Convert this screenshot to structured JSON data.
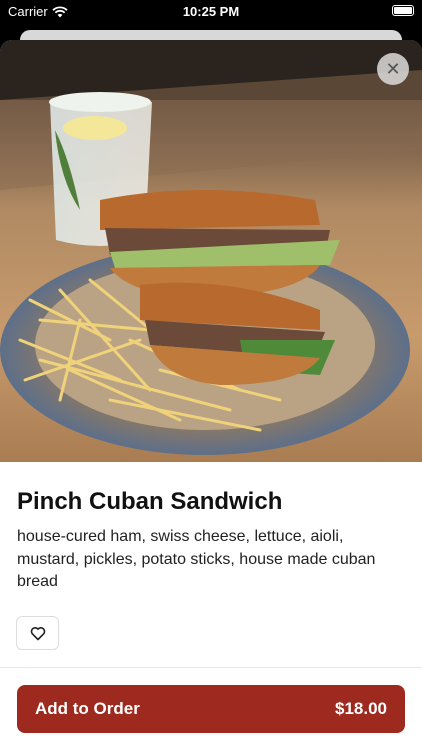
{
  "status_bar": {
    "carrier": "Carrier",
    "time": "10:25 PM"
  },
  "item": {
    "title": "Pinch Cuban Sandwich",
    "description": "house-cured ham, swiss cheese, lettuce, aioli, mustard, pickles, potato sticks, house made cuban bread",
    "price": "$18.00"
  },
  "actions": {
    "add_to_order": "Add to Order",
    "close_symbol": "✕"
  },
  "colors": {
    "accent": "#9e2a1f"
  },
  "icons": [
    "wifi-icon",
    "battery-icon",
    "close-icon",
    "heart-icon"
  ]
}
